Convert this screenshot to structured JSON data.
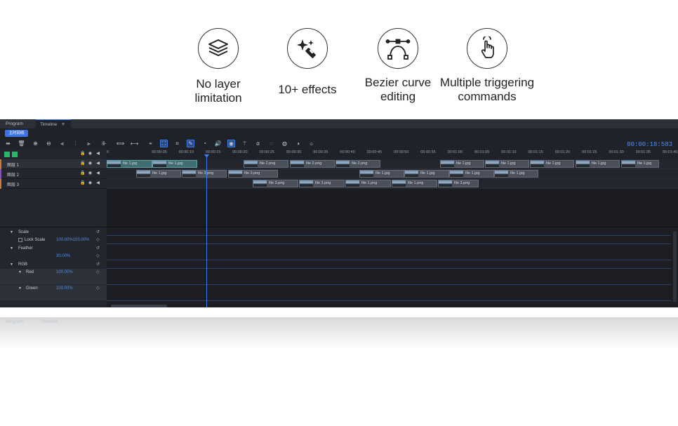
{
  "features": [
    {
      "label_line1": "No layer",
      "label_line2": "limitation",
      "icon": "layers-icon"
    },
    {
      "label_line1": "10+ effects",
      "label_line2": "",
      "icon": "magic-wand-icon"
    },
    {
      "label_line1": "Bezier curve",
      "label_line2": "editing",
      "icon": "bezier-curve-icon"
    },
    {
      "label_line1": "Multiple triggering",
      "label_line2": "commands",
      "icon": "pointer-hand-icon"
    }
  ],
  "app": {
    "tabs": [
      {
        "label": "Program"
      },
      {
        "label": "Timeline"
      }
    ],
    "toolbar": {
      "blue_button": "主时间线",
      "timecode": "00:00:18:583"
    },
    "ruler": [
      "0",
      "00:00:05",
      "00:00:10",
      "00:00:15",
      "00:00:20",
      "00:00:25",
      "00:00:30",
      "00:00:35",
      "00:00:40",
      "00:00:45",
      "00:00:50",
      "00:00:55",
      "00:01:00",
      "00:01:05",
      "00:01:10",
      "00:01:15",
      "00:01:20",
      "00:01:25",
      "00:01:30",
      "00:01:35",
      "00:01:40",
      "00:01:4"
    ],
    "layers": [
      {
        "name": "图层 1"
      },
      {
        "name": "图层 2"
      },
      {
        "name": "图层 3"
      }
    ],
    "clips": {
      "track1": [
        "file 1.jpg",
        "file 1.jpg",
        "file 2.png",
        "file 2.png",
        "file 2.png",
        "file 1.jpg",
        "file 1.jpg",
        "file 1.jpg",
        "file 1.jpg",
        "file 1.jpg"
      ],
      "track2": [
        "file 1.jpg",
        "file 3.png",
        "file 3.png",
        "file 1.jpg",
        "file 1.jpg",
        "file 1.jpg",
        "file 1.jpg"
      ],
      "track3": [
        "file 3.png",
        "file 3.png",
        "file 1.png",
        "file 1.png",
        "file 3.png"
      ]
    },
    "properties": {
      "scale": "Scale",
      "lock_scale": "Lock Scale",
      "scale_value": "100.00%100.00%",
      "feather": "Feather",
      "feather_value": "30.00%",
      "rgb": "RGB",
      "red": "Red",
      "red_value": "100.00%",
      "green": "Green",
      "green_value": "100.00%"
    }
  }
}
